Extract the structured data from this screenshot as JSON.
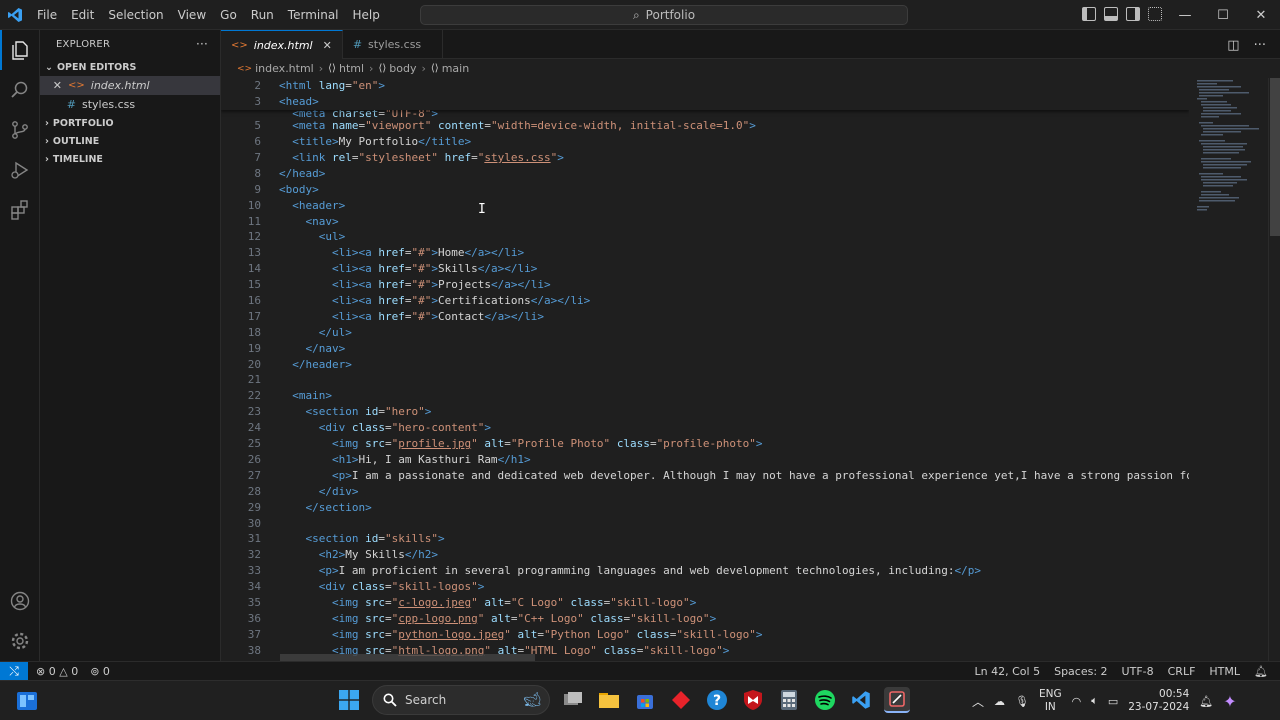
{
  "window": {
    "menu": [
      "File",
      "Edit",
      "Selection",
      "View",
      "Go",
      "Run",
      "Terminal",
      "Help"
    ],
    "search_text": "Portfolio",
    "accent": "#0078d4"
  },
  "explorer": {
    "title": "EXPLORER",
    "more": "···",
    "open_editors_label": "OPEN EDITORS",
    "open_files": [
      {
        "name": "index.html",
        "icon": "html-file-icon",
        "selected": true
      },
      {
        "name": "styles.css",
        "icon": "css-file-icon",
        "selected": false
      }
    ],
    "sections": [
      "PORTFOLIO",
      "OUTLINE",
      "TIMELINE"
    ]
  },
  "tabs": [
    {
      "label": "index.html",
      "active": true
    },
    {
      "label": "styles.css",
      "active": false
    }
  ],
  "breadcrumb": [
    "index.html",
    "html",
    "body",
    "main"
  ],
  "status": {
    "errors": "0",
    "warnings": "0",
    "ports": "0",
    "position": "Ln 42, Col 5",
    "spaces": "Spaces: 2",
    "encoding": "UTF-8",
    "eol": "CRLF",
    "language": "HTML"
  },
  "taskbar": {
    "search_placeholder": "Search",
    "lang": "ENG",
    "region": "IN",
    "time": "00:54",
    "date": "23-07-2024"
  }
}
